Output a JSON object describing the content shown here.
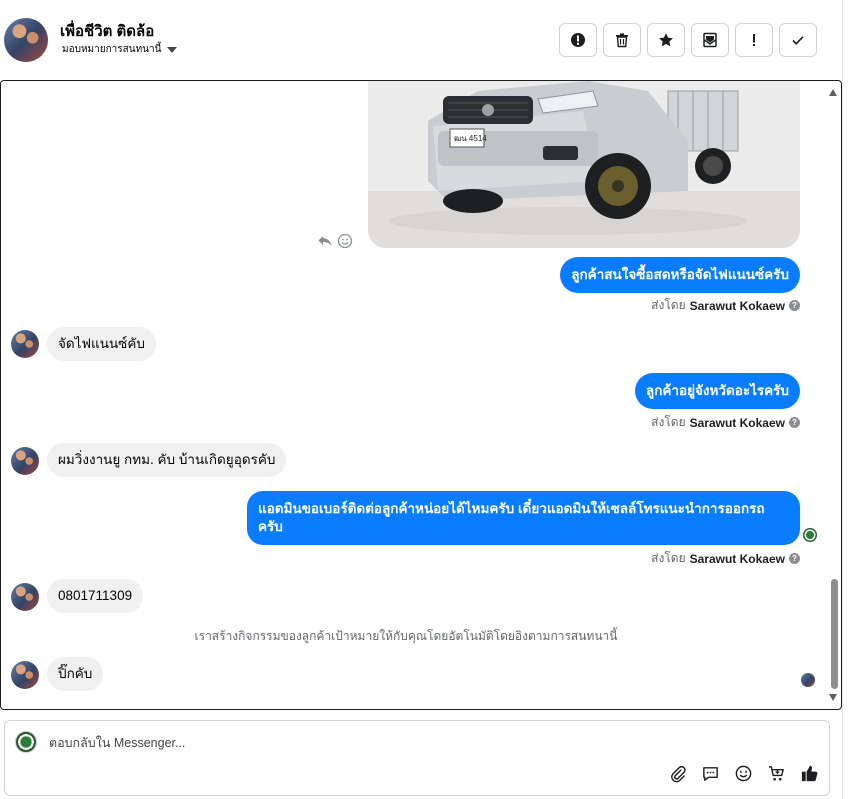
{
  "header": {
    "contact_name": "เพื่อชีวิต ติดล้อ",
    "assign_label": "มอบหมายการสนทนานี้",
    "toolbar": [
      {
        "name": "mark-spam-button",
        "icon": "exclamation-circle-icon"
      },
      {
        "name": "delete-button",
        "icon": "trash-icon"
      },
      {
        "name": "star-button",
        "icon": "star-icon"
      },
      {
        "name": "mark-unread-button",
        "icon": "envelope-icon"
      },
      {
        "name": "follow-up-button",
        "icon": "exclamation-icon"
      },
      {
        "name": "mark-done-button",
        "icon": "check-icon"
      }
    ]
  },
  "conversation": {
    "messages": [
      {
        "direction": "outgoing",
        "text": "ลูกค้าสนใจซื้อสดหรือจัดไฟแนนซ์ครับ",
        "sent_by_prefix": "ส่งโดย",
        "sent_by": "Sarawut Kokaew"
      },
      {
        "direction": "incoming",
        "text": "จัดไฟแนนซ์คับ"
      },
      {
        "direction": "outgoing",
        "text": "ลูกค้าอยู่จังหวัดอะไรครับ",
        "sent_by_prefix": "ส่งโดย",
        "sent_by": "Sarawut Kokaew"
      },
      {
        "direction": "incoming",
        "text": "ผมวิ่งงานยู กทม. คับ บ้านเกิดยูอุดรคับ"
      },
      {
        "direction": "outgoing",
        "text_line1": "แอดมินขอเบอร์ติดต่อลูกค้าหน่อยได้ไหมครับ เดี๋ยวแอดมินให้เซลล์โทรแนะนำการออกรถ",
        "text_line2": "ครับ",
        "sent_by_prefix": "ส่งโดย",
        "sent_by": "Sarawut Kokaew"
      },
      {
        "direction": "incoming",
        "text": "0801711309"
      },
      {
        "direction": "incoming",
        "text": "ปิ๊กคับ"
      }
    ],
    "system_note": "เราสร้างกิจกรรมของลูกค้าเป้าหมายให้กับคุณโดยอัตโนมัติโดยอิงตามการสนทนานี้",
    "plate_text": "ฒน 4514"
  },
  "composer": {
    "placeholder": "ตอบกลับใน Messenger..."
  },
  "colors": {
    "outgoing_bubble": "#0a7cff",
    "incoming_bubble": "#f0f0f0",
    "like_icon": "#1c1e21"
  }
}
